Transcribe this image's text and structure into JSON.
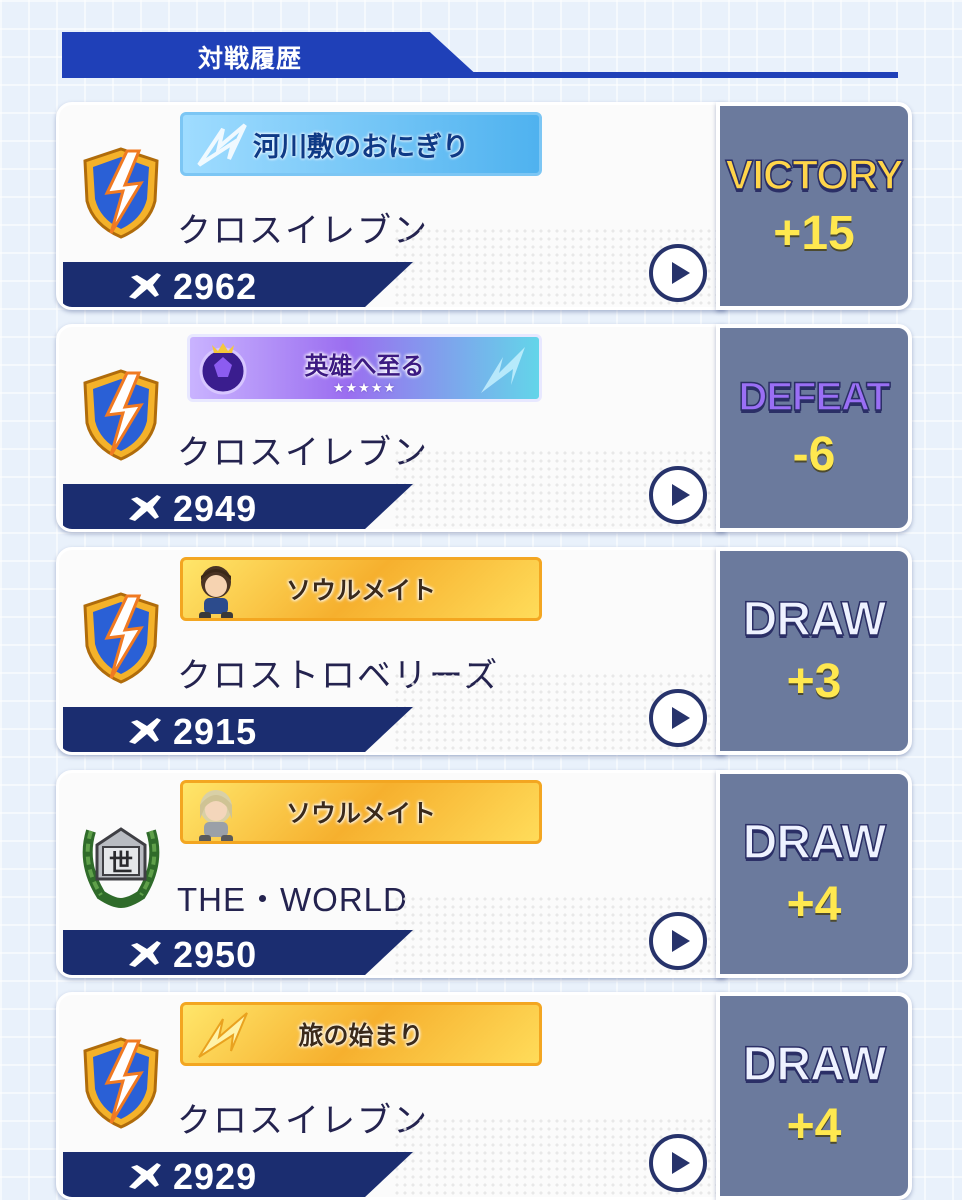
{
  "header": {
    "title": "対戦履歴"
  },
  "colors": {
    "accent": "#1f40b8",
    "rating_bar": "#1b2d70",
    "result_panel": "#6b7a9d",
    "points": "#ffe84f"
  },
  "matches": [
    {
      "title_badge": "河川敷のおにぎり",
      "badge_style": "blue",
      "team_name": "クロスイレブン",
      "emblem": "lightning-shield-emblem-icon",
      "rating": "2962",
      "result": "VICTORY",
      "points": "+15"
    },
    {
      "title_badge": "英雄へ至る",
      "badge_stars": "★★★★★",
      "badge_style": "purple",
      "team_name": "クロスイレブン",
      "emblem": "lightning-shield-emblem-icon",
      "rating": "2949",
      "result": "DEFEAT",
      "points": "-6"
    },
    {
      "title_badge": "ソウルメイト",
      "badge_style": "gold",
      "team_name": "クロストロベリーズ",
      "emblem": "lightning-shield-emblem-icon",
      "rating": "2915",
      "result": "DRAW",
      "points": "+3"
    },
    {
      "title_badge": "ソウルメイト",
      "badge_style": "gold",
      "team_name": "THE・WORLD",
      "emblem": "laurel-world-emblem-icon",
      "emblem_glyph": "世",
      "rating": "2950",
      "result": "DRAW",
      "points": "+4"
    },
    {
      "title_badge": "旅の始まり",
      "badge_style": "gold",
      "team_name": "クロスイレブン",
      "emblem": "lightning-shield-emblem-icon",
      "rating": "2929",
      "result": "DRAW",
      "points": "+4"
    }
  ]
}
